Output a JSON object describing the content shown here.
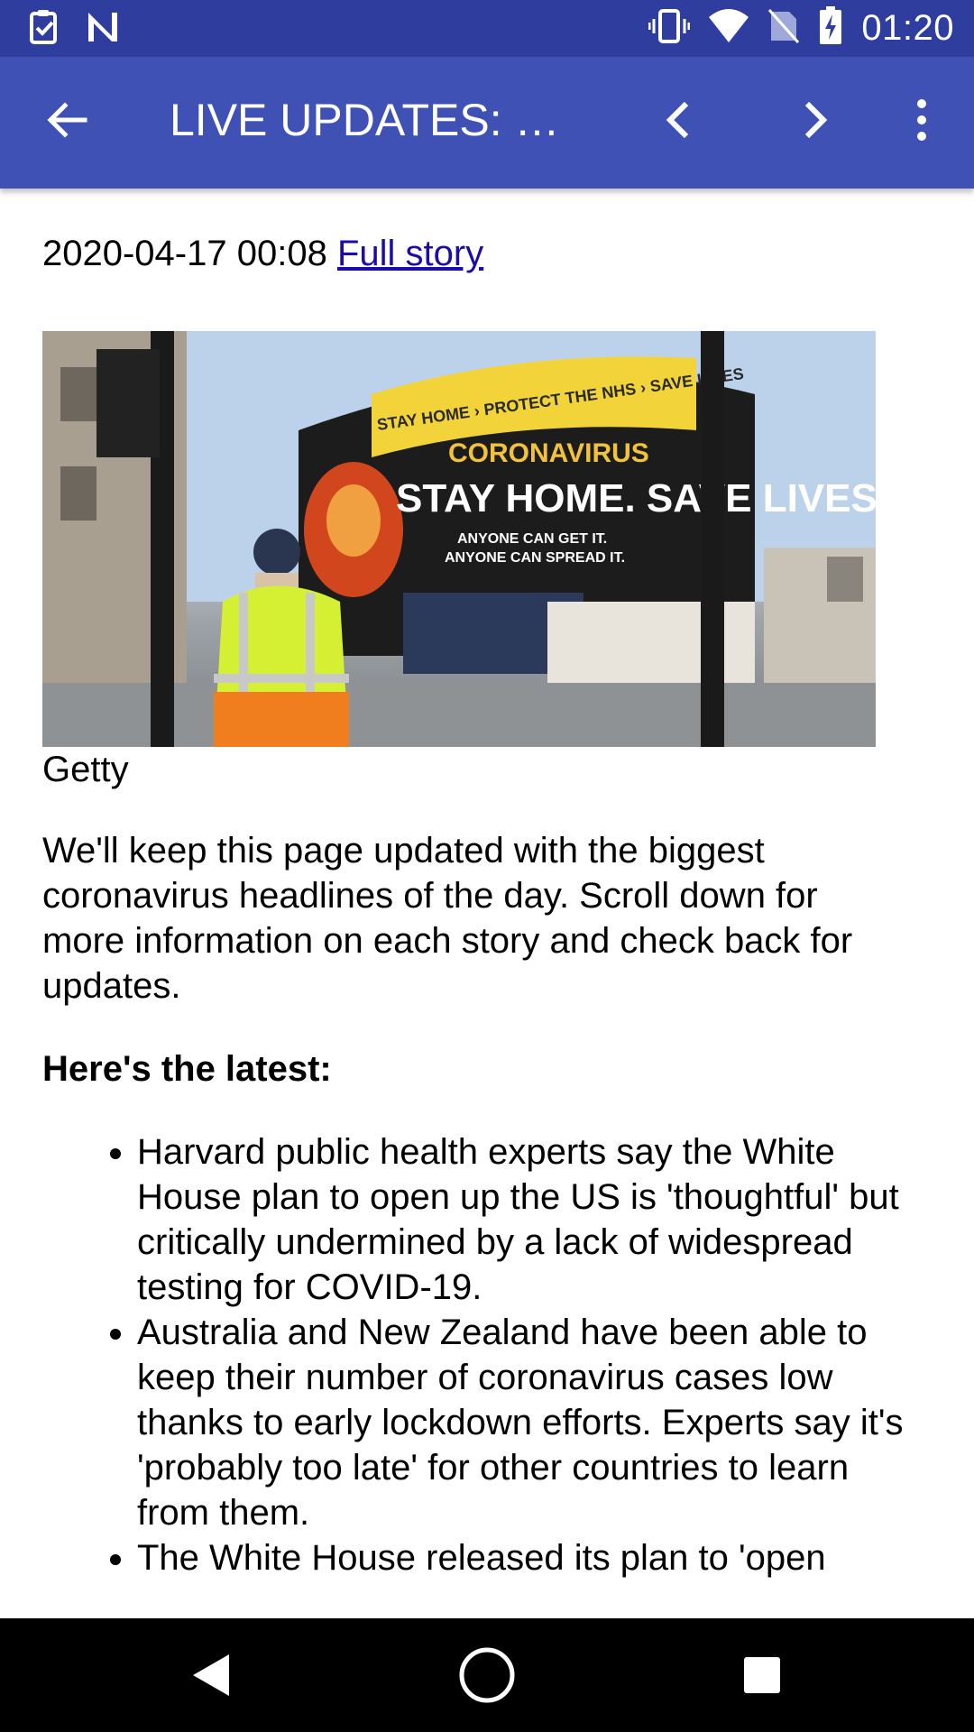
{
  "status_bar": {
    "time": "01:20",
    "icons": [
      "task-check-icon",
      "n-logo-icon",
      "vibrate-icon",
      "wifi-icon",
      "no-sim-icon",
      "battery-charging-icon"
    ]
  },
  "app_bar": {
    "title": "LIVE UPDATES: W…",
    "back_icon": "arrow-back-icon",
    "prev_icon": "chevron-left-icon",
    "next_icon": "chevron-right-icon",
    "menu_icon": "more-vert-icon"
  },
  "article": {
    "timestamp": "2020-04-17 00:08",
    "full_story_link": "Full story",
    "image_caption": "Getty",
    "billboard": {
      "banner": "STAY HOME › PROTECT THE NHS › SAVE LIVES",
      "headline1": "CORONAVIRUS",
      "headline2": "STAY HOME. SAVE LIVES.",
      "line1": "ANYONE CAN GET IT.",
      "line2": "ANYONE CAN SPREAD IT."
    },
    "intro": "We'll keep this page updated with the biggest coronavirus headlines of the day. Scroll down for more information on each story and check back for updates.",
    "subheading": "Here's the latest:",
    "bullets": [
      "Harvard public health experts say the White House plan to open up the US is 'thoughtful' but critically undermined by a lack of widespread testing for COVID-19.",
      "Australia and New Zealand have been able to keep their number of coronavirus cases low thanks to early lockdown efforts. Experts say it's 'probably too late' for other countries to learn from them.",
      "The White House released its plan to 'open"
    ]
  },
  "nav_bar": {
    "back": "nav-back-icon",
    "home": "nav-home-icon",
    "recents": "nav-recents-icon"
  },
  "colors": {
    "status_bar": "#2f3e9e",
    "app_bar": "#3f51b5",
    "link": "#1a0dab"
  }
}
